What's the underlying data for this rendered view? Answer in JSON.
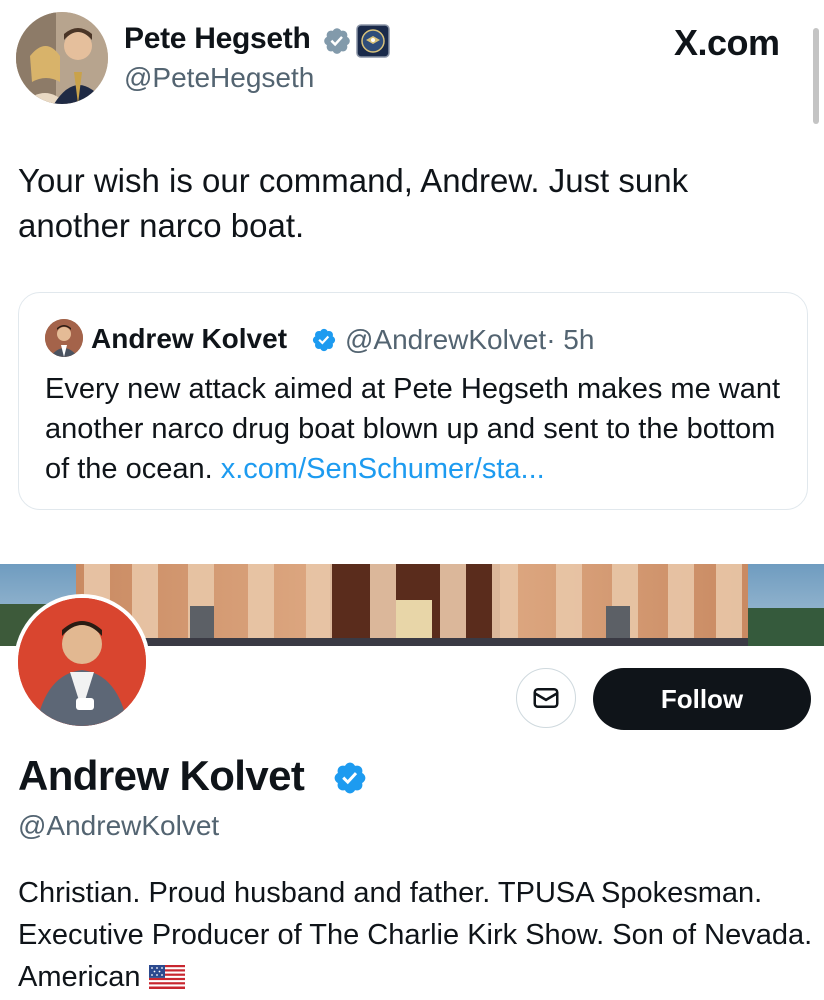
{
  "tweet": {
    "author_name": "Pete Hegseth",
    "author_handle": "@PeteHegseth",
    "site_label": "X.com",
    "text": "Your wish is our command, Andrew. Just sunk another narco boat."
  },
  "quoted_tweet": {
    "author_name": "Andrew Kolvet",
    "author_handle": "@AndrewKolvet",
    "time": "· 5h",
    "text": "Every new attack aimed at Pete Hegseth makes me want another narco drug boat blown up and sent to the bottom of the ocean.",
    "link_text": "x.com/SenSchumer/sta..."
  },
  "profile": {
    "name": "Andrew Kolvet",
    "handle": "@AndrewKolvet",
    "follow_label": "Follow",
    "bio": "Christian. Proud husband and father. TPUSA Spokesman. Executive Producer of The Charlie Kirk Show. Son of Nevada. American"
  },
  "colors": {
    "verified_blue": "#1d9bf0",
    "verified_grey": "#829aab",
    "link_blue": "#1d9bf0",
    "follow_bg": "#0f1419"
  },
  "icons": [
    "verified-grey-icon",
    "dod-seal-icon",
    "verified-blue-icon",
    "mail-icon",
    "us-flag-icon"
  ]
}
